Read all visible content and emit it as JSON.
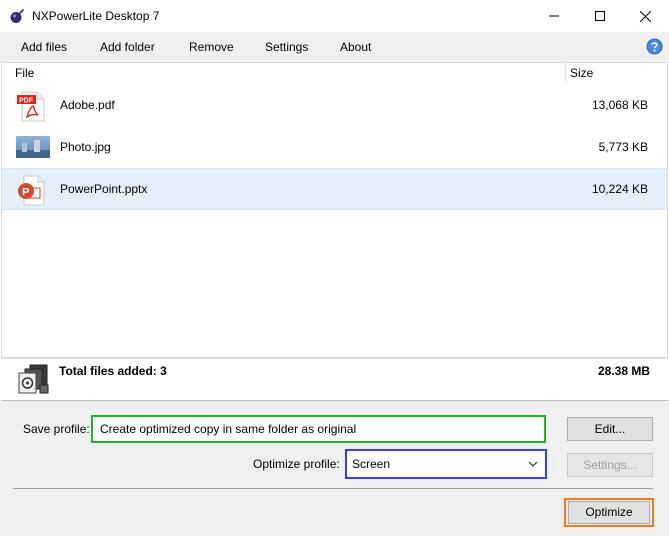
{
  "window": {
    "title": "NXPowerLite Desktop 7",
    "controls": [
      "minimize-icon",
      "maximize-icon",
      "close-icon"
    ]
  },
  "menu": {
    "items": [
      "Add files",
      "Add folder",
      "Remove",
      "Settings",
      "About"
    ],
    "help_icon": "help-icon"
  },
  "list": {
    "columns": {
      "file": "File",
      "size": "Size"
    },
    "rows": [
      {
        "name": "Adobe.pdf",
        "size": "13,068 KB",
        "icon": "pdf-file-icon",
        "icon_label": "PDF",
        "selected": false
      },
      {
        "name": "Photo.jpg",
        "size": "5,773 KB",
        "icon": "image-file-icon",
        "selected": false
      },
      {
        "name": "PowerPoint.pptx",
        "size": "10,224 KB",
        "icon": "pptx-file-icon",
        "selected": true
      }
    ],
    "selected_row_color": "#e5f0fb"
  },
  "summary": {
    "label": "Total files added: 3",
    "total": "28.38 MB",
    "icon": "files-summary-icon"
  },
  "profiles": {
    "save_label": "Save profile:",
    "save_value": "Create optimized copy in same folder as original",
    "save_highlight": "#22b02b",
    "optimize_label": "Optimize profile:",
    "optimize_value": "Screen",
    "optimize_highlight": "#3c3ce6",
    "edit_button": "Edit...",
    "settings_button": "Settings..."
  },
  "actions": {
    "optimize_button": "Optimize",
    "optimize_highlight": "#f27a1e"
  }
}
